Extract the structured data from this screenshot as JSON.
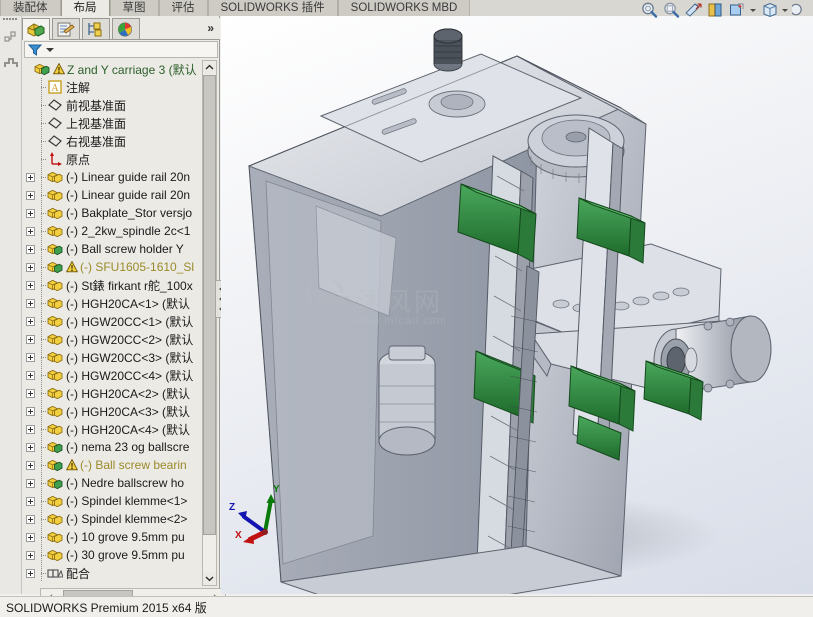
{
  "window": {
    "status_text": "SOLIDWORKS Premium 2015 x64 版"
  },
  "ribbon": {
    "tabs": [
      {
        "label": "装配体",
        "active": false
      },
      {
        "label": "布局",
        "active": true
      },
      {
        "label": "草图",
        "active": false
      },
      {
        "label": "评估",
        "active": false
      },
      {
        "label": "SOLIDWORKS 插件",
        "active": false
      },
      {
        "label": "SOLIDWORKS MBD",
        "active": false
      }
    ]
  },
  "view_toolbar": {
    "items": [
      {
        "name": "zoom-to-fit-icon",
        "glyph": "zoom-fit"
      },
      {
        "name": "zoom-to-area-icon",
        "glyph": "zoom-area"
      },
      {
        "name": "section-view-icon",
        "glyph": "section"
      },
      {
        "name": "view-orientation-icon",
        "glyph": "orient"
      },
      {
        "name": "display-style-icon",
        "glyph": "display",
        "has_caret": true
      },
      {
        "name": "hide-show-items-icon",
        "glyph": "cube",
        "has_caret": true
      },
      {
        "name": "appearance-icon",
        "glyph": "sphere",
        "has_caret": true
      }
    ]
  },
  "left_strip": {
    "items": [
      {
        "name": "flyout-tree-icon"
      },
      {
        "name": "step-graph-icon"
      }
    ]
  },
  "feature_manager": {
    "tabs": [
      {
        "name": "feature-manager-design-tree-tab",
        "label": "FeatureManager 设计树",
        "active": true
      },
      {
        "name": "property-manager-tab",
        "label": "PropertyManager",
        "active": false
      },
      {
        "name": "configuration-manager-tab",
        "label": "ConfigurationManager",
        "active": false
      },
      {
        "name": "display-manager-tab",
        "label": "DisplayManager",
        "active": false
      }
    ],
    "expander_label": "»",
    "filter": {
      "name": "tree-filter",
      "placeholder": ""
    },
    "tree": [
      {
        "label": "Z and Y carriage 3  (默认",
        "icon": "assembly",
        "expandable": false,
        "warning": true,
        "style": "root",
        "indent": 0
      },
      {
        "label": "注解",
        "icon": "annotations",
        "expandable": false,
        "warning": false,
        "style": "normal",
        "indent": 1
      },
      {
        "label": "前视基准面",
        "icon": "plane",
        "expandable": false,
        "warning": false,
        "style": "normal",
        "indent": 1
      },
      {
        "label": "上视基准面",
        "icon": "plane",
        "expandable": false,
        "warning": false,
        "style": "normal",
        "indent": 1
      },
      {
        "label": "右视基准面",
        "icon": "plane",
        "expandable": false,
        "warning": false,
        "style": "normal",
        "indent": 1
      },
      {
        "label": "原点",
        "icon": "origin",
        "expandable": false,
        "warning": false,
        "style": "normal",
        "indent": 1
      },
      {
        "label": "(-) Linear guide rail 20n",
        "icon": "part",
        "expandable": true,
        "warning": false,
        "style": "normal",
        "indent": 1
      },
      {
        "label": "(-) Linear guide rail 20n",
        "icon": "part",
        "expandable": true,
        "warning": false,
        "style": "normal",
        "indent": 1
      },
      {
        "label": "(-) Bakplate_Stor versjo",
        "icon": "part",
        "expandable": true,
        "warning": false,
        "style": "normal",
        "indent": 1
      },
      {
        "label": "(-) 2_2kw_spindle 2c<1",
        "icon": "part",
        "expandable": true,
        "warning": false,
        "style": "normal",
        "indent": 1
      },
      {
        "label": "(-) Ball screw holder Y",
        "icon": "assembly-green",
        "expandable": true,
        "warning": false,
        "style": "normal",
        "indent": 1
      },
      {
        "label": "(-) SFU1605-1610_Sl",
        "icon": "assembly-green",
        "expandable": true,
        "warning": true,
        "style": "err",
        "indent": 1
      },
      {
        "label": "(-) St錶 firkant r舵_100x",
        "icon": "part",
        "expandable": true,
        "warning": false,
        "style": "normal",
        "indent": 1
      },
      {
        "label": "(-) HGH20CA<1> (默认",
        "icon": "part",
        "expandable": true,
        "warning": false,
        "style": "normal",
        "indent": 1
      },
      {
        "label": "(-) HGW20CC<1> (默认",
        "icon": "part",
        "expandable": true,
        "warning": false,
        "style": "normal",
        "indent": 1
      },
      {
        "label": "(-) HGW20CC<2> (默认",
        "icon": "part",
        "expandable": true,
        "warning": false,
        "style": "normal",
        "indent": 1
      },
      {
        "label": "(-) HGW20CC<3> (默认",
        "icon": "part",
        "expandable": true,
        "warning": false,
        "style": "normal",
        "indent": 1
      },
      {
        "label": "(-) HGW20CC<4> (默认",
        "icon": "part",
        "expandable": true,
        "warning": false,
        "style": "normal",
        "indent": 1
      },
      {
        "label": "(-) HGH20CA<2> (默认",
        "icon": "part",
        "expandable": true,
        "warning": false,
        "style": "normal",
        "indent": 1
      },
      {
        "label": "(-) HGH20CA<3> (默认",
        "icon": "part",
        "expandable": true,
        "warning": false,
        "style": "normal",
        "indent": 1
      },
      {
        "label": "(-) HGH20CA<4> (默认",
        "icon": "part",
        "expandable": true,
        "warning": false,
        "style": "normal",
        "indent": 1
      },
      {
        "label": "(-) nema 23 og ballscre",
        "icon": "assembly-green",
        "expandable": true,
        "warning": false,
        "style": "normal",
        "indent": 1
      },
      {
        "label": "(-) Ball screw bearin",
        "icon": "assembly-green",
        "expandable": true,
        "warning": true,
        "style": "err",
        "indent": 1
      },
      {
        "label": "(-) Nedre ballscrew ho",
        "icon": "assembly-green",
        "expandable": true,
        "warning": false,
        "style": "normal",
        "indent": 1
      },
      {
        "label": "(-) Spindel klemme<1>",
        "icon": "part",
        "expandable": true,
        "warning": false,
        "style": "normal",
        "indent": 1
      },
      {
        "label": "(-) Spindel klemme<2>",
        "icon": "part",
        "expandable": true,
        "warning": false,
        "style": "normal",
        "indent": 1
      },
      {
        "label": "(-) 10 grove 9.5mm pu",
        "icon": "part",
        "expandable": true,
        "warning": false,
        "style": "normal",
        "indent": 1
      },
      {
        "label": "(-) 30 grove 9.5mm pu",
        "icon": "part",
        "expandable": true,
        "warning": false,
        "style": "normal",
        "indent": 1
      },
      {
        "label": "配合",
        "icon": "mates",
        "expandable": true,
        "warning": false,
        "style": "normal",
        "indent": 1
      }
    ]
  },
  "graphics": {
    "watermark_text": "沐风网",
    "watermark_url": "www.mfcad.com",
    "triad": {
      "x_label": "X",
      "y_label": "Y",
      "z_label": "Z",
      "x_color": "#cc0000",
      "y_color": "#008800",
      "z_color": "#0000cc"
    },
    "model_colors": {
      "body": "#b9bdc6",
      "green_block": "#2e8b3d",
      "steel": "#c9ccd2"
    }
  }
}
